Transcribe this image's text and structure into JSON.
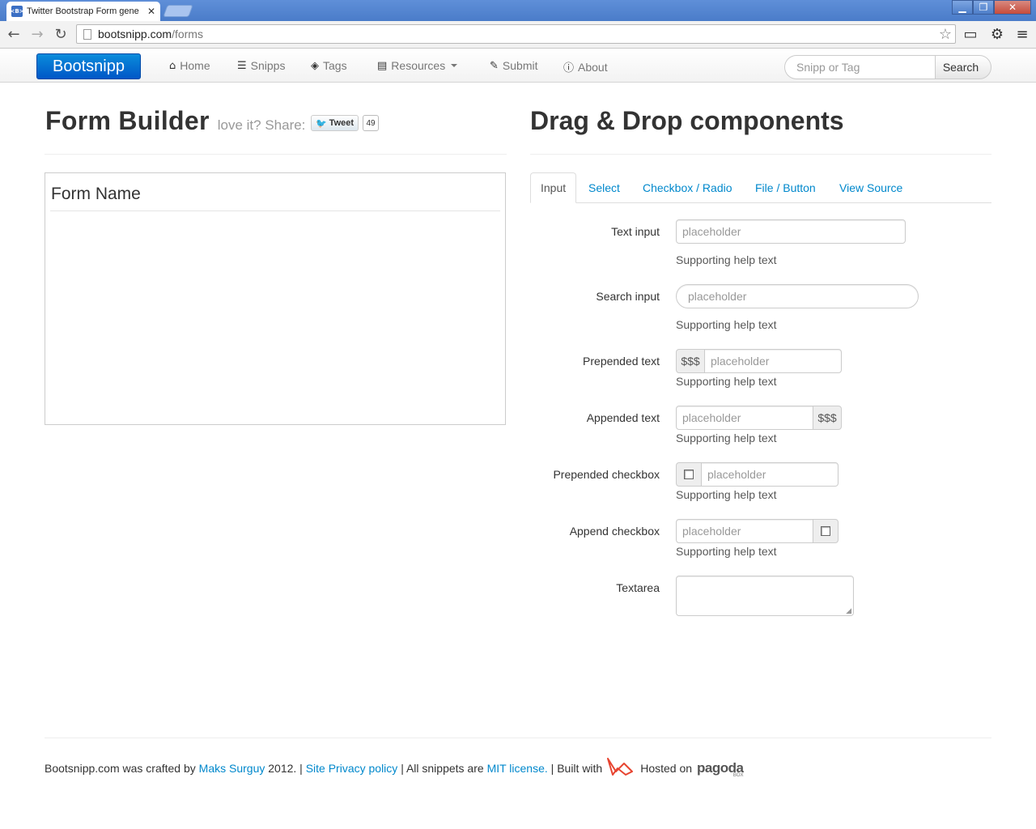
{
  "browser": {
    "tab_title": "Twitter Bootstrap Form gene",
    "favicon_text": "<B>",
    "url_host": "bootsnipp.com",
    "url_path": "/forms"
  },
  "navbar": {
    "brand": "Bootsnipp",
    "links": [
      {
        "icon": "home-icon",
        "label": "Home"
      },
      {
        "icon": "list-icon",
        "label": "Snipps"
      },
      {
        "icon": "tags-icon",
        "label": "Tags"
      },
      {
        "icon": "book-icon",
        "label": "Resources"
      },
      {
        "icon": "pencil-icon",
        "label": "Submit"
      },
      {
        "icon": "info-icon",
        "label": "About"
      }
    ],
    "search_placeholder": "Snipp or Tag",
    "search_button": "Search"
  },
  "builder": {
    "title": "Form Builder",
    "share_text": "love it? Share:",
    "tweet_label": "Tweet",
    "tweet_count": "49",
    "form_name": "Form Name"
  },
  "components": {
    "title": "Drag & Drop components",
    "tabs": [
      "Input",
      "Select",
      "Checkbox / Radio",
      "File / Button",
      "View Source"
    ],
    "active_tab": "Input",
    "fields": {
      "text_input": {
        "label": "Text input",
        "placeholder": "placeholder",
        "help": "Supporting help text"
      },
      "search_input": {
        "label": "Search input",
        "placeholder": "placeholder",
        "help": "Supporting help text"
      },
      "prepended_text": {
        "label": "Prepended text",
        "addon": "$$$",
        "placeholder": "placeholder",
        "help": "Supporting help text"
      },
      "appended_text": {
        "label": "Appended text",
        "addon": "$$$",
        "placeholder": "placeholder",
        "help": "Supporting help text"
      },
      "prepended_checkbox": {
        "label": "Prepended checkbox",
        "placeholder": "placeholder",
        "help": "Supporting help text"
      },
      "append_checkbox": {
        "label": "Append checkbox",
        "placeholder": "placeholder",
        "help": "Supporting help text"
      },
      "textarea": {
        "label": "Textarea"
      }
    }
  },
  "footer": {
    "text1": "Bootsnipp.com was crafted by",
    "author": "Maks Surguy",
    "text2": "2012. |",
    "privacy": "Site Privacy policy",
    "text3": "| All snippets are",
    "license": "MIT license.",
    "text4": "| Built with",
    "text5": "Hosted on",
    "host_logo": "pagoda",
    "host_logo_sub": "BOX"
  }
}
